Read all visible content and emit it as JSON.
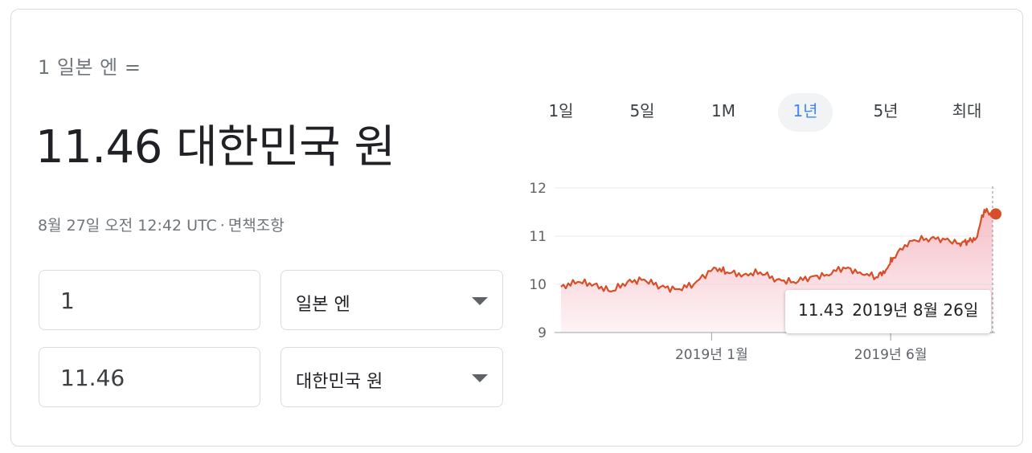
{
  "header": {
    "from_label": "1 일본 엔 =",
    "result": "11.46 대한민국 원",
    "timestamp": "8월 27일 오전 12:42 UTC",
    "separator": "·",
    "disclaimer": "면책조항"
  },
  "converter": {
    "from_amount": "1",
    "from_currency": "일본 엔",
    "to_amount": "11.46",
    "to_currency": "대한민국 원"
  },
  "tabs": [
    {
      "label": "1일",
      "active": false
    },
    {
      "label": "5일",
      "active": false
    },
    {
      "label": "1M",
      "active": false
    },
    {
      "label": "1년",
      "active": true
    },
    {
      "label": "5년",
      "active": false
    },
    {
      "label": "최대",
      "active": false
    }
  ],
  "tooltip": {
    "value": "11.43",
    "date": "2019년 8월 26일"
  },
  "colors": {
    "line": "#d74f29",
    "fill_top": "#f4b4bf",
    "active_tab": "#4285f4"
  },
  "chart_data": {
    "type": "area",
    "title": "",
    "xlabel": "",
    "ylabel": "",
    "ylim": [
      9,
      12
    ],
    "yticks": [
      12,
      11,
      10,
      9
    ],
    "xtick_labels": [
      "2019년 1월",
      "2019년 6월"
    ],
    "xtick_positions": [
      "2019-01",
      "2019-06"
    ],
    "grid": true,
    "x": [
      "2018-08-27",
      "2018-09-10",
      "2018-09-24",
      "2018-10-08",
      "2018-10-22",
      "2018-11-05",
      "2018-11-19",
      "2018-12-03",
      "2018-12-17",
      "2019-01-03",
      "2019-01-14",
      "2019-01-28",
      "2019-02-11",
      "2019-02-25",
      "2019-03-11",
      "2019-03-25",
      "2019-04-08",
      "2019-04-22",
      "2019-05-06",
      "2019-05-20",
      "2019-05-28",
      "2019-06-03",
      "2019-06-17",
      "2019-07-01",
      "2019-07-15",
      "2019-07-29",
      "2019-08-05",
      "2019-08-12",
      "2019-08-19",
      "2019-08-26"
    ],
    "series": [
      {
        "values": [
          9.95,
          10.05,
          10.0,
          9.85,
          10.05,
          10.1,
          9.95,
          9.9,
          10.0,
          10.35,
          10.25,
          10.2,
          10.25,
          10.1,
          10.05,
          10.15,
          10.2,
          10.35,
          10.25,
          10.15,
          10.3,
          10.55,
          10.9,
          10.95,
          10.95,
          10.85,
          10.9,
          10.95,
          11.55,
          11.43
        ]
      }
    ]
  }
}
